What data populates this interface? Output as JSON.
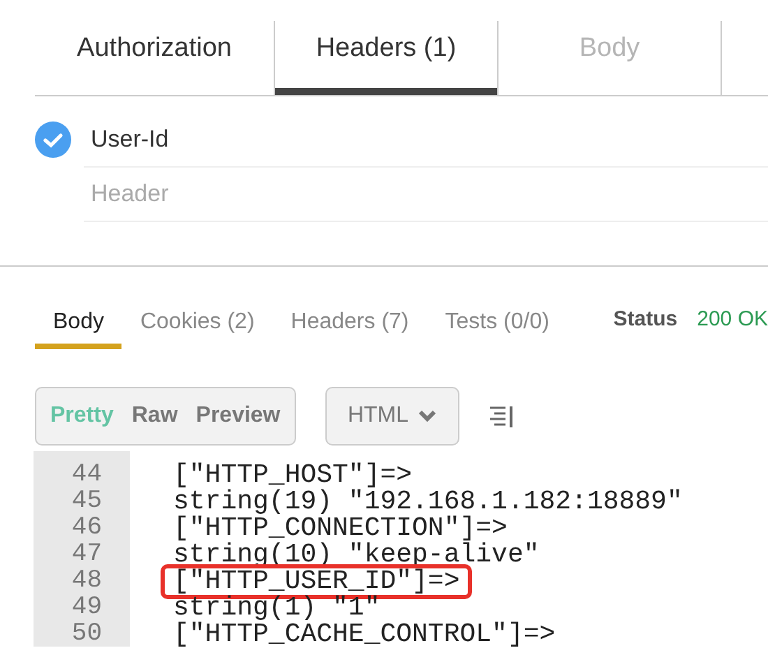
{
  "request_tabs": [
    {
      "label": "Authorization",
      "selected": false,
      "disabled": false
    },
    {
      "label": "Headers (1)",
      "selected": true,
      "disabled": false
    },
    {
      "label": "Body",
      "selected": false,
      "disabled": true
    }
  ],
  "headers": {
    "rows": [
      {
        "key": "User-Id",
        "checked": true
      }
    ],
    "placeholder": "Header"
  },
  "response_tabs": [
    {
      "label": "Body",
      "selected": true
    },
    {
      "label": "Cookies (2)",
      "selected": false
    },
    {
      "label": "Headers (7)",
      "selected": false
    },
    {
      "label": "Tests (0/0)",
      "selected": false
    }
  ],
  "status": {
    "label": "Status",
    "value": "200 OK"
  },
  "view_modes": [
    {
      "label": "Pretty",
      "selected": true
    },
    {
      "label": "Raw",
      "selected": false
    },
    {
      "label": "Preview",
      "selected": false
    }
  ],
  "format": "HTML",
  "code": [
    {
      "number": "44",
      "text": "[\"HTTP_HOST\"]=>",
      "highlighted": false
    },
    {
      "number": "45",
      "text": "string(19) \"192.168.1.182:18889\"",
      "highlighted": false
    },
    {
      "number": "46",
      "text": "[\"HTTP_CONNECTION\"]=>",
      "highlighted": false
    },
    {
      "number": "47",
      "text": "string(10) \"keep-alive\"",
      "highlighted": false
    },
    {
      "number": "48",
      "text": "[\"HTTP_USER_ID\"]=>",
      "highlighted": true
    },
    {
      "number": "49",
      "text": "string(1) \"1\"",
      "highlighted": false
    },
    {
      "number": "50",
      "text": "[\"HTTP_CACHE_CONTROL\"]=>",
      "highlighted": false
    }
  ]
}
